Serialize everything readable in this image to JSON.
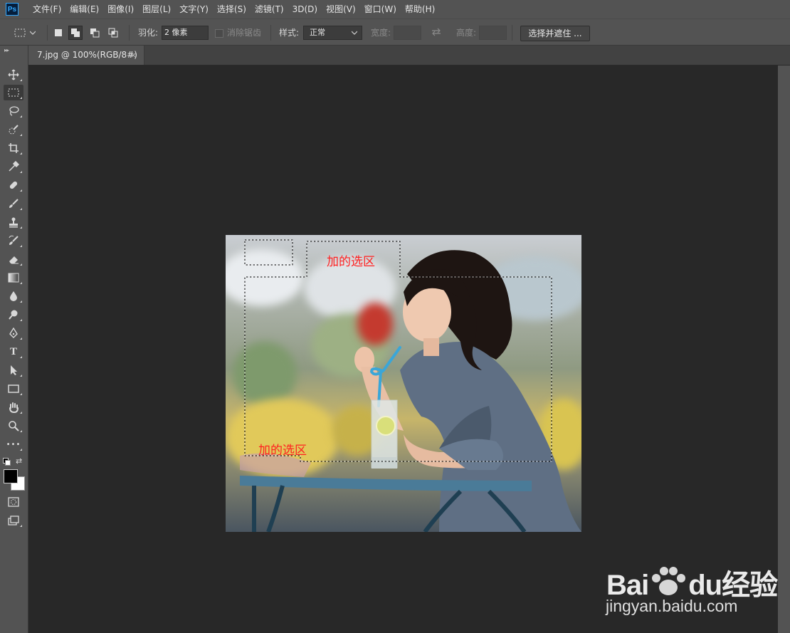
{
  "app": {
    "logo_text": "Ps"
  },
  "menu": [
    "文件(F)",
    "编辑(E)",
    "图像(I)",
    "图层(L)",
    "文字(Y)",
    "选择(S)",
    "滤镜(T)",
    "3D(D)",
    "视图(V)",
    "窗口(W)",
    "帮助(H)"
  ],
  "options": {
    "feather_label": "羽化:",
    "feather_value": "2 像素",
    "antialias_label": "消除锯齿",
    "style_label": "样式:",
    "style_value": "正常",
    "width_label": "宽度:",
    "height_label": "高度:",
    "select_mask_button": "选择并遮住 ..."
  },
  "document": {
    "tab_title": "7.jpg @ 100%(RGB/8#)",
    "close_glyph": "×"
  },
  "canvas": {
    "annotation_top": "加的选区",
    "annotation_bottom": "加的选区"
  },
  "watermark": {
    "logo_text": "Bai🐾du经验",
    "brand_left": "Bai",
    "brand_right": "du经验",
    "url": "jingyan.baidu.com"
  },
  "toolbar": {
    "tools": [
      "move-tool",
      "rectangular-marquee-tool",
      "lasso-tool",
      "quick-selection-tool",
      "crop-tool",
      "eyedropper-tool",
      "healing-brush-tool",
      "brush-tool",
      "clone-stamp-tool",
      "history-brush-tool",
      "eraser-tool",
      "gradient-tool",
      "blur-tool",
      "dodge-tool",
      "pen-tool",
      "type-tool",
      "path-selection-tool",
      "rectangle-tool",
      "hand-tool",
      "zoom-tool",
      "more-tools"
    ],
    "type_tool_glyph": "T",
    "more_glyph": "•••"
  },
  "colors": {
    "foreground": "#000000",
    "background": "#ffffff",
    "annotation": "#ff2020",
    "ui_panel": "#535353",
    "workspace": "#282828"
  }
}
